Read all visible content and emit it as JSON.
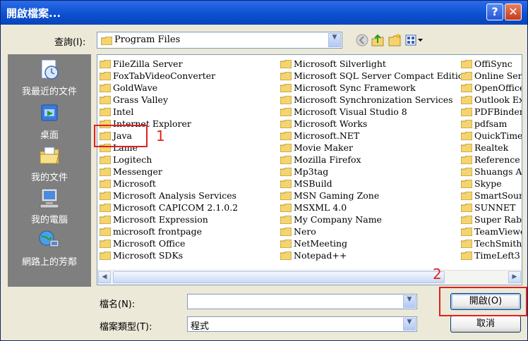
{
  "window": {
    "title": "開啟檔案..."
  },
  "lookin": {
    "label": "查詢(I):",
    "value": "Program Files"
  },
  "places": [
    {
      "label": "我最近的文件",
      "icon": "recent-docs-icon"
    },
    {
      "label": "桌面",
      "icon": "desktop-icon"
    },
    {
      "label": "我的文件",
      "icon": "my-documents-icon"
    },
    {
      "label": "我的電腦",
      "icon": "my-computer-icon"
    },
    {
      "label": "網路上的芳鄰",
      "icon": "network-icon"
    }
  ],
  "files": {
    "col1": [
      "FileZilla Server",
      "FoxTabVideoConverter",
      "GoldWave",
      "Grass Valley",
      "Intel",
      "Internet Explorer",
      "Java",
      "Lame",
      "Logitech",
      "Messenger",
      "Microsoft",
      "Microsoft Analysis Services",
      "Microsoft CAPICOM 2.1.0.2",
      "Microsoft Expression",
      "microsoft frontpage",
      "Microsoft Office",
      "Microsoft SDKs"
    ],
    "col2": [
      "Microsoft Silverlight",
      "Microsoft SQL Server Compact Edition",
      "Microsoft Sync Framework",
      "Microsoft Synchronization Services",
      "Microsoft Visual Studio 8",
      "Microsoft Works",
      "Microsoft.NET",
      "Movie Maker",
      "Mozilla Firefox",
      "Mp3tag",
      "MSBuild",
      "MSN Gaming Zone",
      "MSXML 4.0",
      "My Company Name",
      "Nero",
      "NetMeeting",
      "Notepad++"
    ],
    "col3": [
      "OffiSync",
      "Online Serv",
      "OpenOffice",
      "Outlook Ex",
      "PDFBinder",
      "pdfsam",
      "QuickTime",
      "Realtek",
      "Reference A",
      "Shuangs Au",
      "Skype",
      "SmartSound",
      "SUNNET",
      "Super Rabb",
      "TeamViewe",
      "TechSmith",
      "TimeLeft3"
    ]
  },
  "filename": {
    "label": "檔名(N):",
    "value": ""
  },
  "filetype": {
    "label": "檔案類型(T):",
    "value": "程式"
  },
  "buttons": {
    "open": "開啟(O)",
    "cancel": "取消",
    "help": "?",
    "close": "✕"
  },
  "annotations": {
    "one": "1",
    "two": "2"
  },
  "colors": {
    "title_bar": "#0a4fd0",
    "annotation": "#e02020",
    "places_bar": "#7f7f7f"
  }
}
